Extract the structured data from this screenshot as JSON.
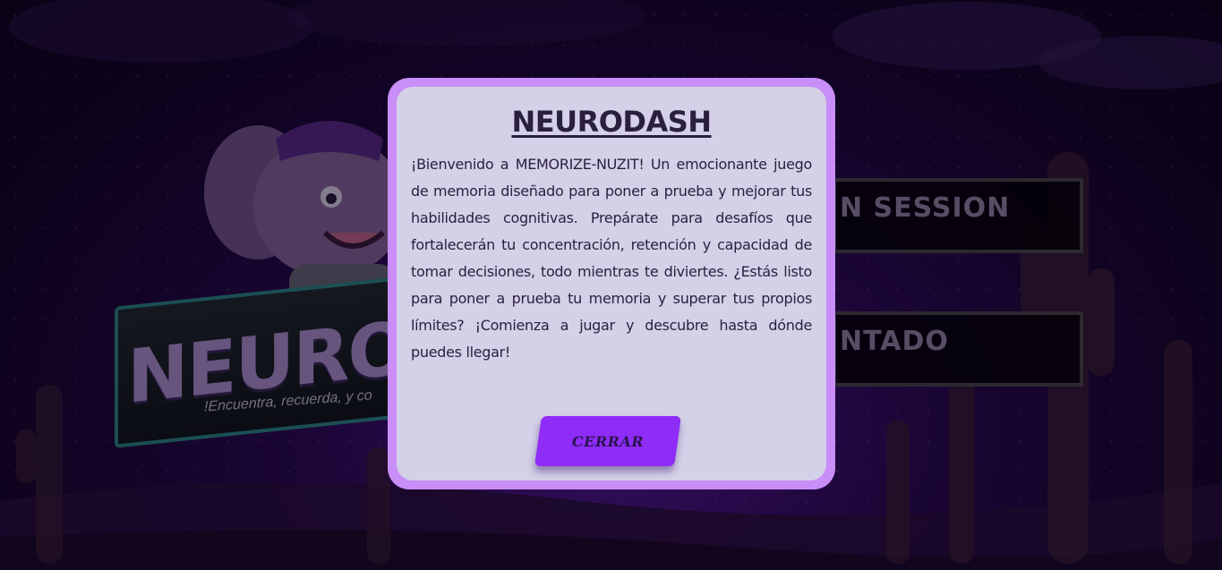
{
  "background": {
    "logo_text": "NEURODASH",
    "logo_tagline": "!Encuentra, recuerda, y co"
  },
  "menu": {
    "login_label": "N SESSION",
    "results_label": "NTADO"
  },
  "modal": {
    "title": "NEURODASH",
    "body": "¡Bienvenido a MEMORIZE-NUZIT! Un emocionante juego de memoria diseñado para poner a prueba y mejorar tus habilidades cognitivas. Prepárate para desafíos que fortalecerán tu concentración, retención y capacidad de tomar decisiones, todo mientras te diviertes. ¿Estás listo para poner a prueba tu memoria y superar tus propios límites? ¡Comienza a jugar y descubre hasta dónde puedes llegar!",
    "close_label": "CERRAR"
  },
  "colors": {
    "modal_border": "#c98ef7",
    "modal_bg": "#d3d0e7",
    "button_bg": "#8f2cf7",
    "text": "#2a1f3c"
  }
}
